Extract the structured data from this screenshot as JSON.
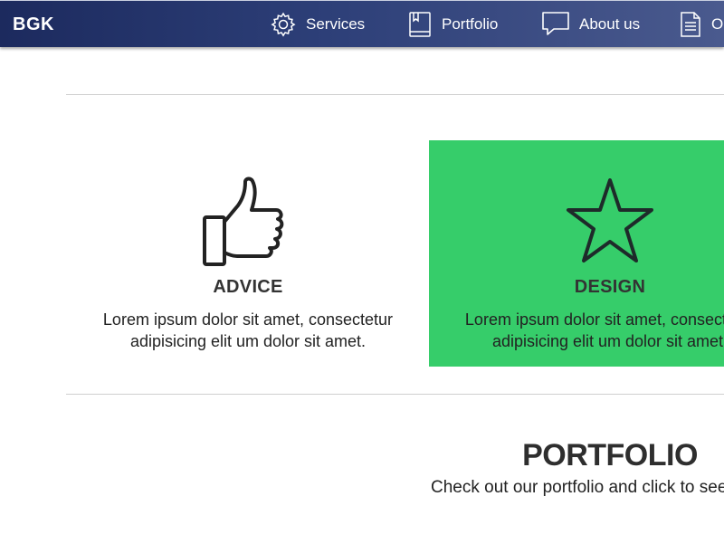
{
  "nav": {
    "brand": "BGK",
    "items": [
      {
        "label": "Services",
        "icon": "gear-icon"
      },
      {
        "label": "Portfolio",
        "icon": "book-icon"
      },
      {
        "label": "About us",
        "icon": "speech-bubble-icon"
      },
      {
        "label": "O",
        "icon": "document-icon"
      }
    ]
  },
  "features": [
    {
      "icon": "thumbs-up-icon",
      "title": "ADVICE",
      "text_line1": "Lorem ipsum dolor sit amet, consectetur",
      "text_line2": "adipisicing elit um dolor sit amet."
    },
    {
      "icon": "star-icon",
      "title": "DESIGN",
      "text_line1": "Lorem ipsum dolor sit amet, consectetur",
      "text_line2": "adipisicing elit um dolor sit amet.",
      "background": "#36cd6a"
    }
  ],
  "portfolio": {
    "title": "PORTFOLIO",
    "subtitle": "Check out our portfolio and click to see"
  },
  "colors": {
    "navbar": "#1c2a5e",
    "accent_green": "#36cd6a"
  }
}
